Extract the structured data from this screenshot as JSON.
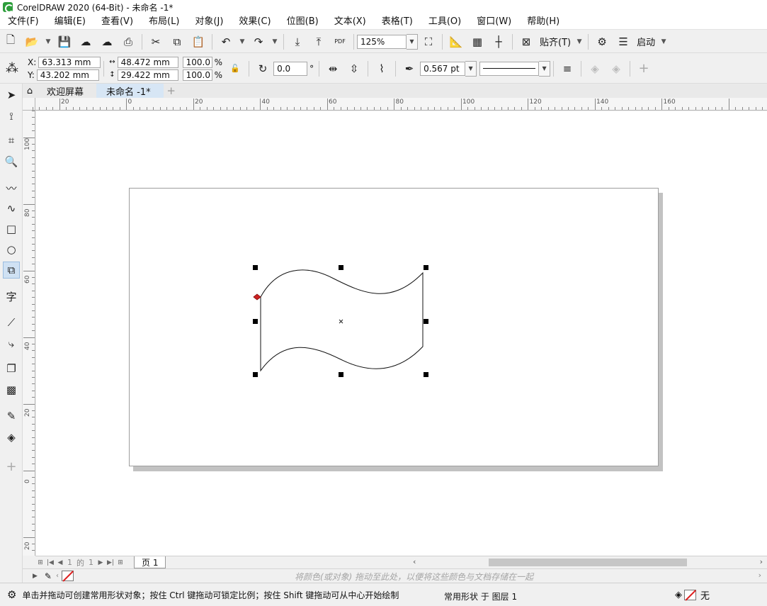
{
  "window": {
    "title": "CorelDRAW 2020 (64-Bit) - 未命名 -1*"
  },
  "menu": [
    "文件(F)",
    "编辑(E)",
    "查看(V)",
    "布局(L)",
    "对象(J)",
    "效果(C)",
    "位图(B)",
    "文本(X)",
    "表格(T)",
    "工具(O)",
    "窗口(W)",
    "帮助(H)"
  ],
  "toolbar": {
    "zoom": "125%",
    "snap_label": "贴齐(T)",
    "launch_label": "启动",
    "pdf_label": "PDF"
  },
  "property_bar": {
    "x_label": "X:",
    "y_label": "Y:",
    "x": "63.313 mm",
    "y": "43.202 mm",
    "width": "48.472 mm",
    "height": "29.422 mm",
    "scale_x": "100.0",
    "scale_y": "100.0",
    "pct_x": "%",
    "pct_y": "%",
    "rotation": "0.0",
    "degree_symbol": "°",
    "outline_width": "0.567 pt"
  },
  "tabs": [
    "欢迎屏幕",
    "未命名 -1*"
  ],
  "ruler": {
    "h_labels": [
      "20",
      "0",
      "20",
      "40",
      "60",
      "80",
      "100",
      "120",
      "140",
      "160"
    ],
    "v_labels": [
      "100",
      "80",
      "60",
      "40",
      "20",
      "0",
      "20"
    ]
  },
  "page_nav": {
    "current": "1",
    "of": "的",
    "total": "1",
    "page_tab": "页 1"
  },
  "palette": {
    "hint": "将颜色(或对象) 拖动至此处，以便将这些颜色与文档存储在一起"
  },
  "status": {
    "hint": "单击并拖动可创建常用形状对象；按住 Ctrl 键拖动可锁定比例；按住 Shift 键拖动可从中心开始绘制",
    "layer": "常用形状 于 图层 1",
    "fill_value": "无"
  },
  "icons": {
    "toolbox": [
      "pick-tool-icon",
      "shape-tool-icon",
      "crop-tool-icon",
      "zoom-tool-icon",
      "freehand-tool-icon",
      "artistic-media-icon",
      "rectangle-tool-icon",
      "ellipse-tool-icon",
      "common-shapes-icon",
      "text-tool-icon",
      "parallel-dimension-icon",
      "connector-tool-icon",
      "drop-shadow-icon",
      "transparency-icon",
      "eyedropper-icon",
      "interactive-fill-icon",
      "add-tool-icon"
    ]
  },
  "colors": {
    "accent": "#d7e6f5",
    "selection_node": "#cc2222"
  }
}
